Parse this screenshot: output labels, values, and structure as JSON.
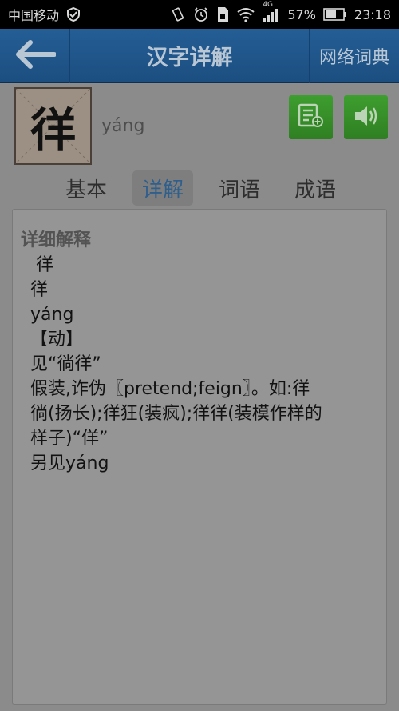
{
  "status": {
    "carrier": "中国移动",
    "network": "4G",
    "battery": "57%",
    "time": "23:18"
  },
  "header": {
    "back_icon": "arrow-left-icon",
    "title": "汉字详解",
    "net_dict": "网络词典"
  },
  "character": {
    "glyph": "徉",
    "pinyin": "yáng",
    "add_note_icon": "add-note-icon",
    "sound_icon": "speaker-icon"
  },
  "tabs": [
    {
      "label": "基本",
      "active": false
    },
    {
      "label": "详解",
      "active": true
    },
    {
      "label": "词语",
      "active": false
    },
    {
      "label": "成语",
      "active": false
    }
  ],
  "detail": {
    "heading": "详细解释",
    "lines": [
      "徉",
      "徉",
      "yáng",
      "【动】",
      "见“徜徉”",
      "假装,诈伪〖pretend;feign〗。如:徉",
      "徜(扬长);徉狂(装疯);徉徉(装模作样的",
      "样子)“佯”",
      "另见yáng"
    ]
  },
  "colors": {
    "header_bg": "#1f5688",
    "button_green": "#36902a",
    "active_tab_text": "#2f5f8c"
  }
}
